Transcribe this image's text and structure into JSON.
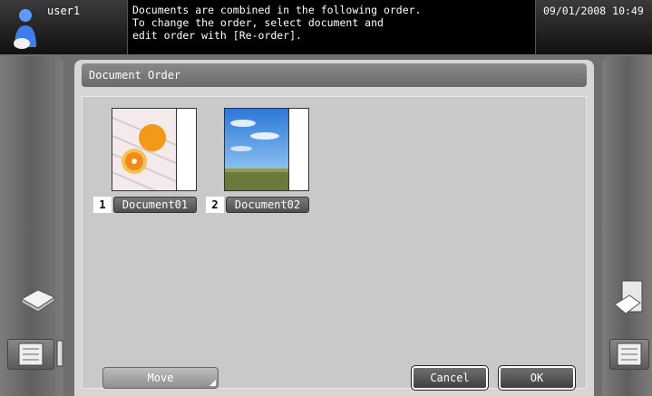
{
  "header": {
    "user_name": "user1",
    "message_lines": [
      "Documents are combined in the following order.",
      "To change the order, select document and",
      "edit order with [Re-order]."
    ],
    "datetime": "09/01/2008 10:49"
  },
  "panel": {
    "title": "Document Order",
    "documents": [
      {
        "number": "1",
        "name": "Document01",
        "thumbnail": "orange-photo"
      },
      {
        "number": "2",
        "name": "Document02",
        "thumbnail": "sky-field-photo"
      }
    ],
    "move_label": "Move",
    "cancel_label": "Cancel",
    "ok_label": "OK"
  },
  "side": {
    "left_icons": [
      "scanner-icon",
      "job-list-icon",
      "toner-icon"
    ],
    "right_icons": [
      "printer-icon",
      "job-list-icon"
    ]
  }
}
